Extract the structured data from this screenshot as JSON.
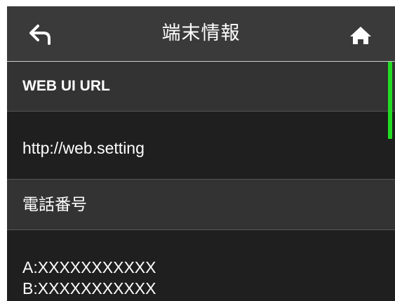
{
  "header": {
    "title": "端末情報",
    "back_icon": "back-arrow-icon",
    "home_icon": "home-icon"
  },
  "items": [
    {
      "kind": "section",
      "label": "WEB UI URL"
    },
    {
      "kind": "value",
      "text": "http://web.setting"
    },
    {
      "kind": "section",
      "label": "電話番号"
    },
    {
      "kind": "value",
      "lines": [
        "A:XXXXXXXXXXX",
        "B:XXXXXXXXXXX"
      ]
    }
  ],
  "colors": {
    "header_bg": "#3a3a3a",
    "content_bg": "#222222",
    "scrollbar": "#22dd22",
    "text": "#ffffff"
  }
}
